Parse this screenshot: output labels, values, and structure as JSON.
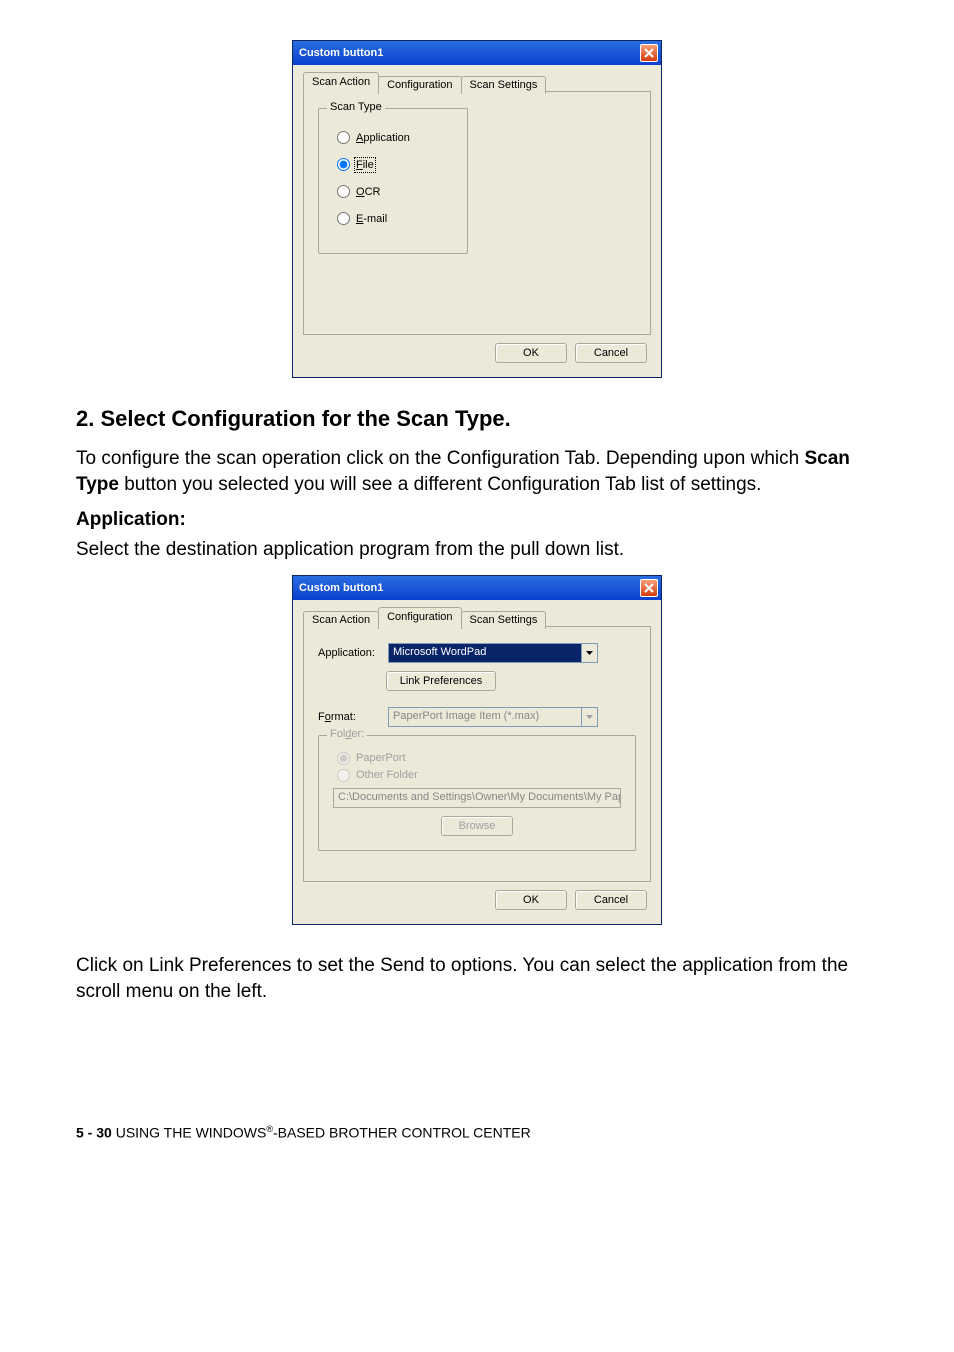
{
  "dialog1": {
    "title": "Custom button1",
    "tabs": {
      "scanAction": "Scan Action",
      "configuration": "Configuration",
      "scanSettings": "Scan Settings"
    },
    "groupTitle": "Scan Type",
    "options": {
      "application": "Application",
      "file": "File",
      "ocr": "OCR",
      "email": "E-mail"
    },
    "buttons": {
      "ok": "OK",
      "cancel": "Cancel"
    }
  },
  "doc": {
    "heading": "2. Select Configuration for the Scan Type.",
    "para1a": "To configure the scan operation click on the Configuration Tab. Depending upon which ",
    "para1bold": "Scan Type",
    "para1b": " button you selected you will see a different Configuration Tab list of settings.",
    "subhead": "Application:",
    "para2": "Select the destination application program from the pull down list."
  },
  "dialog2": {
    "title": "Custom button1",
    "tabs": {
      "scanAction": "Scan Action",
      "configuration": "Configuration",
      "scanSettings": "Scan Settings"
    },
    "appLabel": "Application:",
    "appValue": "Microsoft WordPad",
    "linkPrefs": "Link Preferences",
    "formatLabel": "Format:",
    "formatValue": "PaperPort Image Item (*.max)",
    "folderGroup": "Folder:",
    "paperport": "PaperPort",
    "otherFolder": "Other Folder",
    "path": "C:\\Documents and Settings\\Owner\\My Documents\\My Pape",
    "browse": "Browse",
    "buttons": {
      "ok": "OK",
      "cancel": "Cancel"
    }
  },
  "para3": "Click on Link Preferences to set the Send to options. You can select the application from the scroll menu on the left.",
  "footer": {
    "pageRef": "5 - 30",
    "textA": "   USING THE WINDOWS",
    "reg": "®",
    "textB": "-BASED BROTHER CONTROL CENTER"
  }
}
